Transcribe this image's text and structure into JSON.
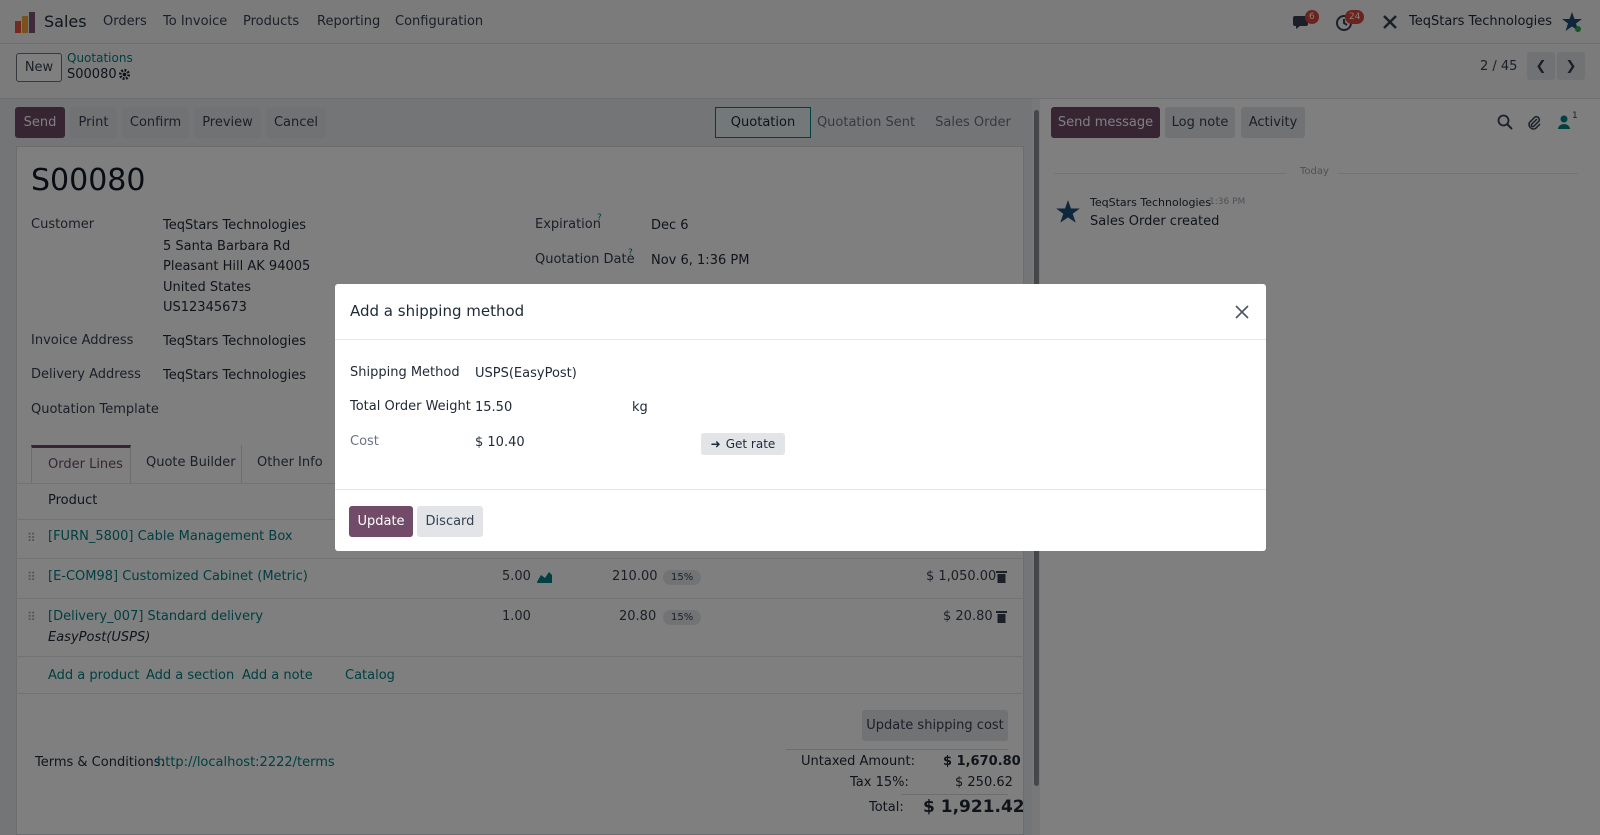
{
  "topnav": {
    "app_name": "Sales",
    "menu": [
      "Orders",
      "To Invoice",
      "Products",
      "Reporting",
      "Configuration"
    ],
    "messages_count": "6",
    "activities_count": "24",
    "company": "TeqStars Technologies"
  },
  "control": {
    "new_label": "New",
    "breadcrumb_parent": "Quotations",
    "breadcrumb_current": "S00080",
    "pager": "2 / 45"
  },
  "actions": {
    "send": "Send",
    "print": "Print",
    "confirm": "Confirm",
    "preview": "Preview",
    "cancel": "Cancel"
  },
  "status": {
    "stages": [
      "Quotation",
      "Quotation Sent",
      "Sales Order"
    ],
    "active": "Quotation"
  },
  "form": {
    "title": "S00080",
    "customer_label": "Customer",
    "customer_name": "TeqStars Technologies",
    "customer_address": [
      "5 Santa Barbara Rd",
      "Pleasant Hill AK 94005",
      "United States",
      "US12345673"
    ],
    "invoice_label": "Invoice Address",
    "invoice_value": "TeqStars Technologies",
    "delivery_label": "Delivery Address",
    "delivery_value": "TeqStars Technologies",
    "template_label": "Quotation Template",
    "expiration_label": "Expiration",
    "expiration_value": "Dec 6",
    "quotation_date_label": "Quotation Date",
    "quotation_date_value": "Nov 6, 1:36 PM",
    "help_mark": "?"
  },
  "tabs": [
    "Order Lines",
    "Quote Builder",
    "Other Info"
  ],
  "table": {
    "product_header": "Product",
    "rows": [
      {
        "product": "[FURN_5800] Cable Management Box",
        "qty": "",
        "price": "",
        "tax": "",
        "subtotal": "",
        "note": ""
      },
      {
        "product": "[E-COM98] Customized Cabinet (Metric)",
        "qty": "5.00",
        "price": "210.00",
        "tax": "15%",
        "subtotal": "$ 1,050.00",
        "note": ""
      },
      {
        "product": "[Delivery_007] Standard delivery",
        "qty": "1.00",
        "price": "20.80",
        "tax": "15%",
        "subtotal": "$ 20.80",
        "note": "EasyPost(USPS)"
      }
    ],
    "add_product": "Add a product",
    "add_section": "Add a section",
    "add_note": "Add a note",
    "catalog": "Catalog"
  },
  "footer": {
    "update_shipping": "Update shipping cost",
    "terms_label": "Terms & Conditions:",
    "terms_link": "http://localhost:2222/terms",
    "untaxed_label": "Untaxed Amount:",
    "untaxed_value": "$ 1,670.80",
    "tax_label": "Tax 15%:",
    "tax_value": "$ 250.62",
    "total_label": "Total:",
    "total_value": "$ 1,921.42"
  },
  "chatter": {
    "send_message": "Send message",
    "log_note": "Log note",
    "activity": "Activity",
    "followers_count": "1",
    "date_sep": "Today",
    "author": "TeqStars Technologies",
    "time": "1:36 PM",
    "message": "Sales Order created"
  },
  "dialog": {
    "title": "Add a shipping method",
    "shipping_method_label": "Shipping Method",
    "shipping_method_value": "USPS(EasyPost)",
    "weight_label": "Total Order Weight",
    "weight_value": "15.50",
    "weight_unit": "kg",
    "cost_label": "Cost",
    "cost_value": "$ 10.40",
    "get_rate": "Get rate",
    "update": "Update",
    "discard": "Discard"
  },
  "colors": {
    "primary": "#714b67",
    "link": "#017e84",
    "badge": "#d9453b"
  }
}
